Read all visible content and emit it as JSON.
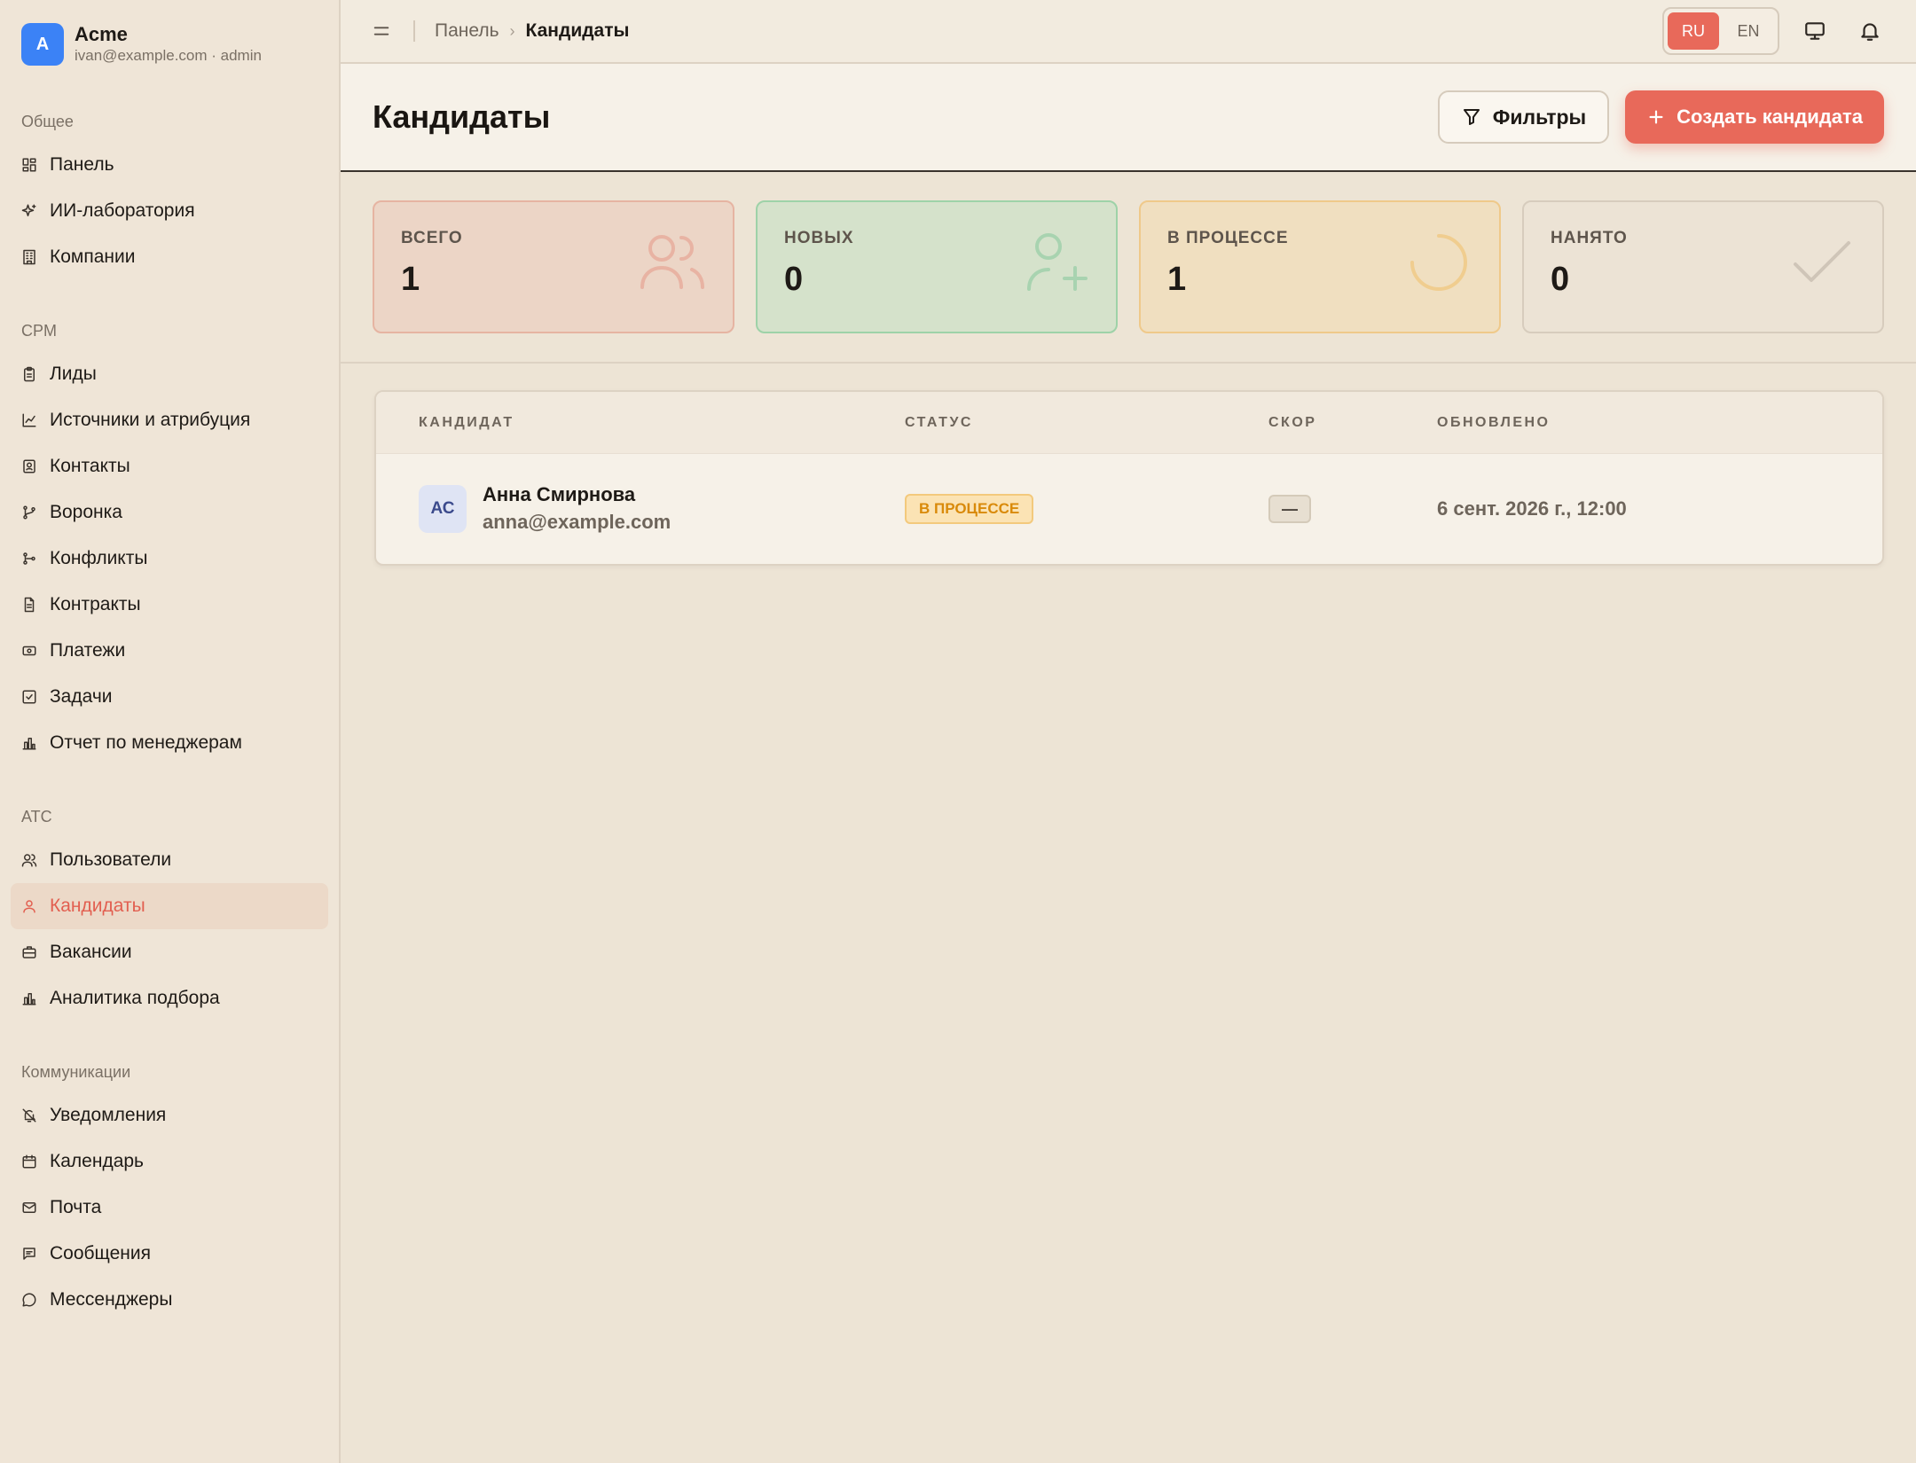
{
  "brand": {
    "initial": "A",
    "name": "Acme",
    "subtitle": "ivan@example.com · admin"
  },
  "sidebar": {
    "sections": [
      {
        "title": "Общее",
        "items": [
          {
            "label": "Панель",
            "icon": "dashboard-icon"
          },
          {
            "label": "ИИ-лаборатория",
            "icon": "sparkles-icon"
          },
          {
            "label": "Компании",
            "icon": "building-icon"
          }
        ]
      },
      {
        "title": "CPM",
        "items": [
          {
            "label": "Лиды",
            "icon": "clipboard-icon"
          },
          {
            "label": "Источники и атрибуция",
            "icon": "chart-line-icon"
          },
          {
            "label": "Контакты",
            "icon": "contact-card-icon"
          },
          {
            "label": "Воронка",
            "icon": "git-branch-icon"
          },
          {
            "label": "Конфликты",
            "icon": "git-merge-icon"
          },
          {
            "label": "Контракты",
            "icon": "file-text-icon"
          },
          {
            "label": "Платежи",
            "icon": "banknote-icon"
          },
          {
            "label": "Задачи",
            "icon": "check-square-icon"
          },
          {
            "label": "Отчет по менеджерам",
            "icon": "bar-chart-icon"
          }
        ]
      },
      {
        "title": "ATC",
        "items": [
          {
            "label": "Пользователи",
            "icon": "users-icon"
          },
          {
            "label": "Кандидаты",
            "icon": "user-icon",
            "active": true
          },
          {
            "label": "Вакансии",
            "icon": "briefcase-icon"
          },
          {
            "label": "Аналитика подбора",
            "icon": "bar-chart-icon"
          }
        ]
      },
      {
        "title": "Коммуникации",
        "items": [
          {
            "label": "Уведомления",
            "icon": "bell-off-icon"
          },
          {
            "label": "Календарь",
            "icon": "calendar-icon"
          },
          {
            "label": "Почта",
            "icon": "mail-icon"
          },
          {
            "label": "Сообщения",
            "icon": "message-square-icon"
          },
          {
            "label": "Мессенджеры",
            "icon": "message-circle-icon"
          }
        ]
      }
    ]
  },
  "topbar": {
    "breadcrumb": {
      "parent": "Панель",
      "separator": "›",
      "current": "Кандидаты"
    },
    "languages": {
      "ru": "RU",
      "en": "EN",
      "active": "RU"
    }
  },
  "page": {
    "title": "Кандидаты",
    "filters_label": "Фильтры",
    "create_label": "Создать кандидата"
  },
  "stats": {
    "total": {
      "label": "ВСЕГО",
      "value": "1",
      "icon": "users-icon"
    },
    "new": {
      "label": "НОВЫХ",
      "value": "0",
      "icon": "user-plus-icon"
    },
    "in_progress": {
      "label": "В ПРОЦЕССЕ",
      "value": "1",
      "icon": "loader-icon"
    },
    "hired": {
      "label": "НАНЯТО",
      "value": "0",
      "icon": "check-icon"
    }
  },
  "table": {
    "headers": {
      "candidate": "КАНДИДАТ",
      "status": "СТАТУС",
      "score": "СКОР",
      "updated": "ОБНОВЛЕНО"
    },
    "rows": [
      {
        "initials": "АС",
        "name": "Анна Смирнова",
        "email": "anna@example.com",
        "status": "В ПРОЦЕССЕ",
        "score": "—",
        "updated": "6 сент. 2026 г., 12:00"
      }
    ]
  },
  "colors": {
    "accent": "#e8695a",
    "brand_avatar": "#3b82f6",
    "status_in_progress": "#d98a0a"
  }
}
